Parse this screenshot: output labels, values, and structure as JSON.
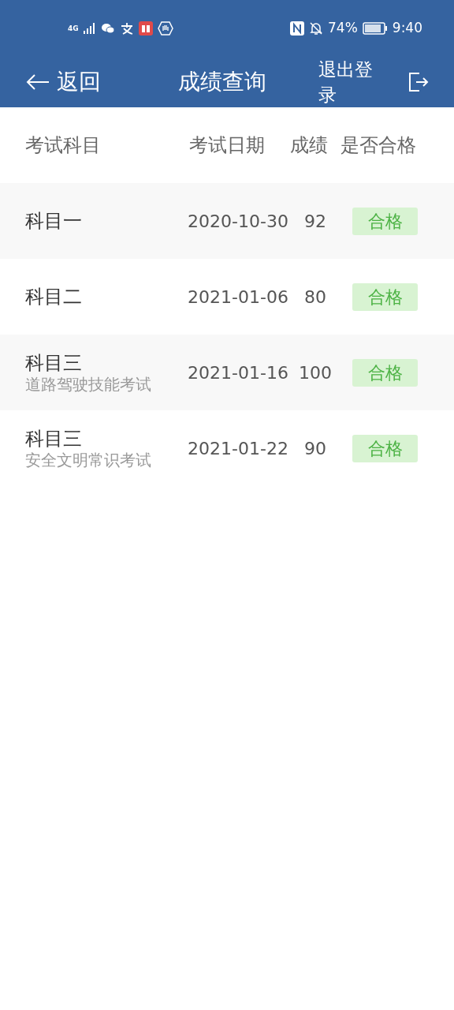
{
  "status_bar": {
    "network": "4G",
    "battery": "74%",
    "time": "9:40"
  },
  "header": {
    "back": "返回",
    "title": "成绩查询",
    "logout": "退出登录"
  },
  "table": {
    "columns": [
      "考试科目",
      "考试日期",
      "成绩",
      "是否合格"
    ],
    "rows": [
      {
        "subject": "科目一",
        "date": "2020-10-30",
        "score": "92",
        "result": "合格",
        "passed": true
      },
      {
        "subject": "科目二",
        "date": "2021-01-06",
        "score": "80",
        "result": "合格",
        "passed": true
      },
      {
        "subject": "科目三",
        "subtitle": "道路驾驶技能考试",
        "date": "2021-01-16",
        "score": "100",
        "result": "合格",
        "passed": true
      },
      {
        "subject": "科目三",
        "subtitle": "安全文明常识考试",
        "date": "2021-01-22",
        "score": "90",
        "result": "合格",
        "passed": true
      }
    ]
  }
}
